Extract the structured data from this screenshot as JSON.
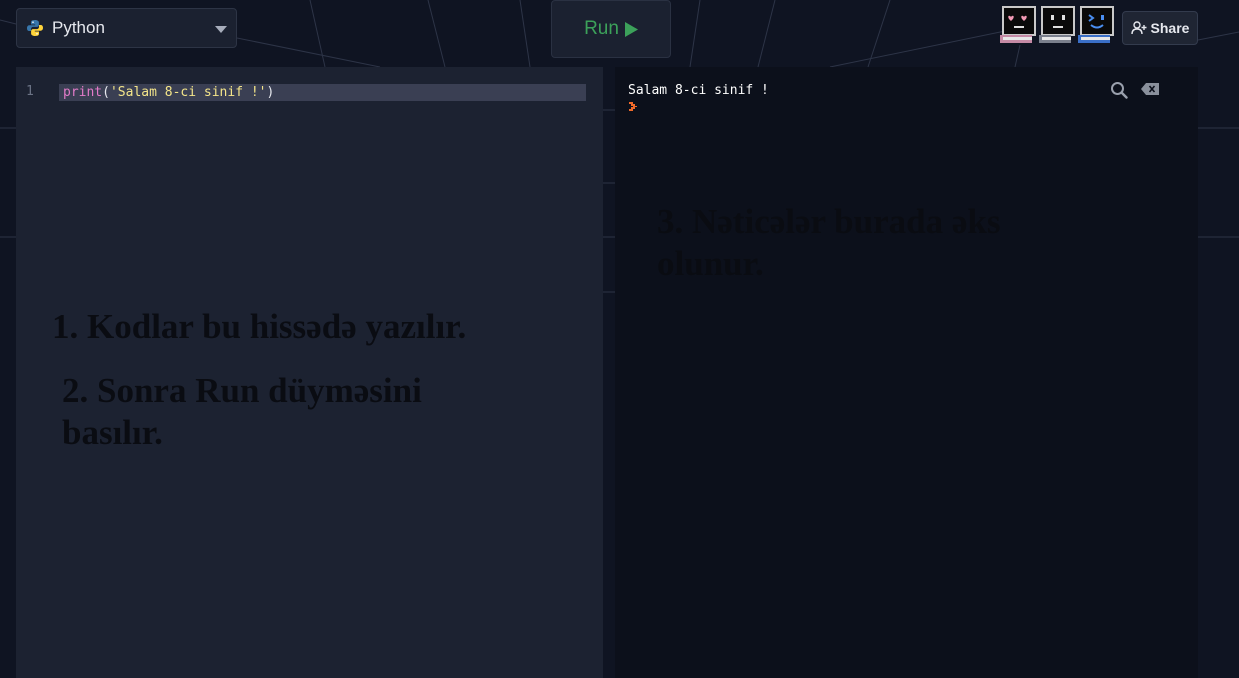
{
  "header": {
    "language": "Python",
    "run_label": "Run",
    "share_label": "Share"
  },
  "editor": {
    "line_number": "1",
    "code": {
      "fn": "print",
      "open": "(",
      "string": "'Salam 8-ci sinif !'",
      "close": ")"
    },
    "annotations": {
      "step1": "1. Kodlar bu hissədə yazılır.",
      "step2_line1": "2. Sonra Run düyməsini",
      "step2_line2": "basılır."
    }
  },
  "console": {
    "output": "Salam 8-ci sinif !",
    "annotations": {
      "step3_line1": "3. Nəticələr burada əks",
      "step3_line2": "olunur."
    }
  },
  "icons": {
    "language": "python-logo-icon",
    "dropdown": "chevron-down-icon",
    "run": "play-icon",
    "share": "user-plus-icon",
    "search": "search-icon",
    "clear": "clear-icon",
    "prompt": "prompt-chevron-icon"
  },
  "colors": {
    "run_green": "#3ca15a",
    "keyword_pink": "#e27bc9",
    "string_yellow": "#f4e58a",
    "prompt_orange": "#f06a2a"
  }
}
